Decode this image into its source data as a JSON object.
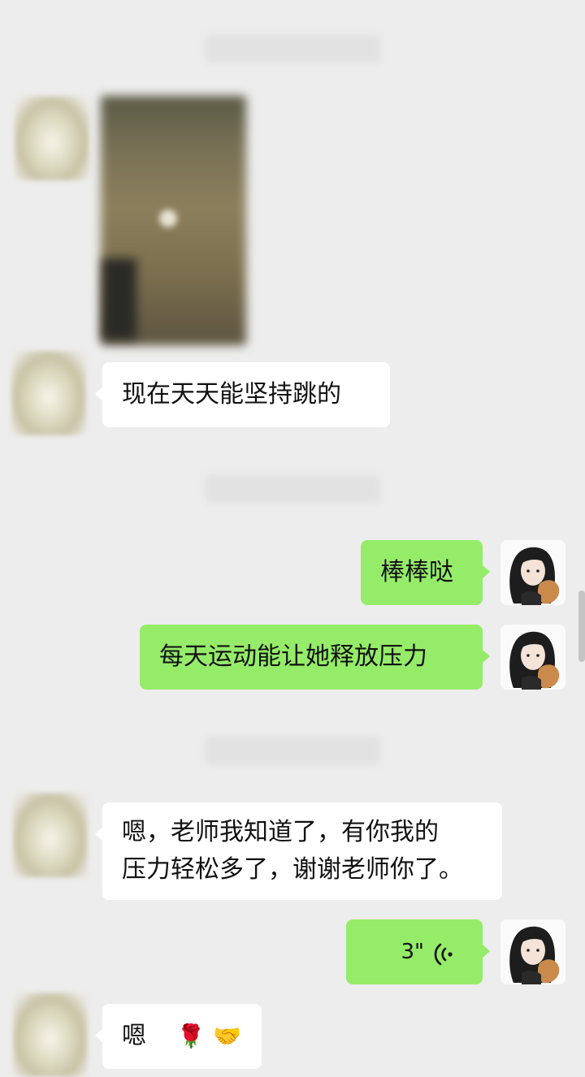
{
  "app": "WeChat",
  "colors": {
    "background": "#ededed",
    "self_bubble": "#95ec69",
    "other_bubble": "#ffffff"
  },
  "messages": {
    "m1": {
      "sender": "other",
      "type": "image"
    },
    "m2": {
      "sender": "other",
      "type": "text",
      "text": "现在天天能坚持跳的"
    },
    "m3": {
      "sender": "self",
      "type": "text",
      "text": "棒棒哒"
    },
    "m4": {
      "sender": "self",
      "type": "text",
      "text": "每天运动能让她释放压力"
    },
    "m5": {
      "sender": "other",
      "type": "text",
      "line1": "嗯，老师我知道了，有你我的",
      "line2": "压力轻松多了，谢谢老师你了。"
    },
    "m6": {
      "sender": "self",
      "type": "voice",
      "duration": "3\"",
      "icon": "voice-wave-icon"
    },
    "m7": {
      "sender": "other",
      "type": "text",
      "text": "嗯",
      "emojis": [
        "🌹",
        "🤝"
      ]
    }
  },
  "icons": {
    "other_avatar": "blurred-avatar",
    "self_avatar": "girl-with-cat-avatar"
  }
}
